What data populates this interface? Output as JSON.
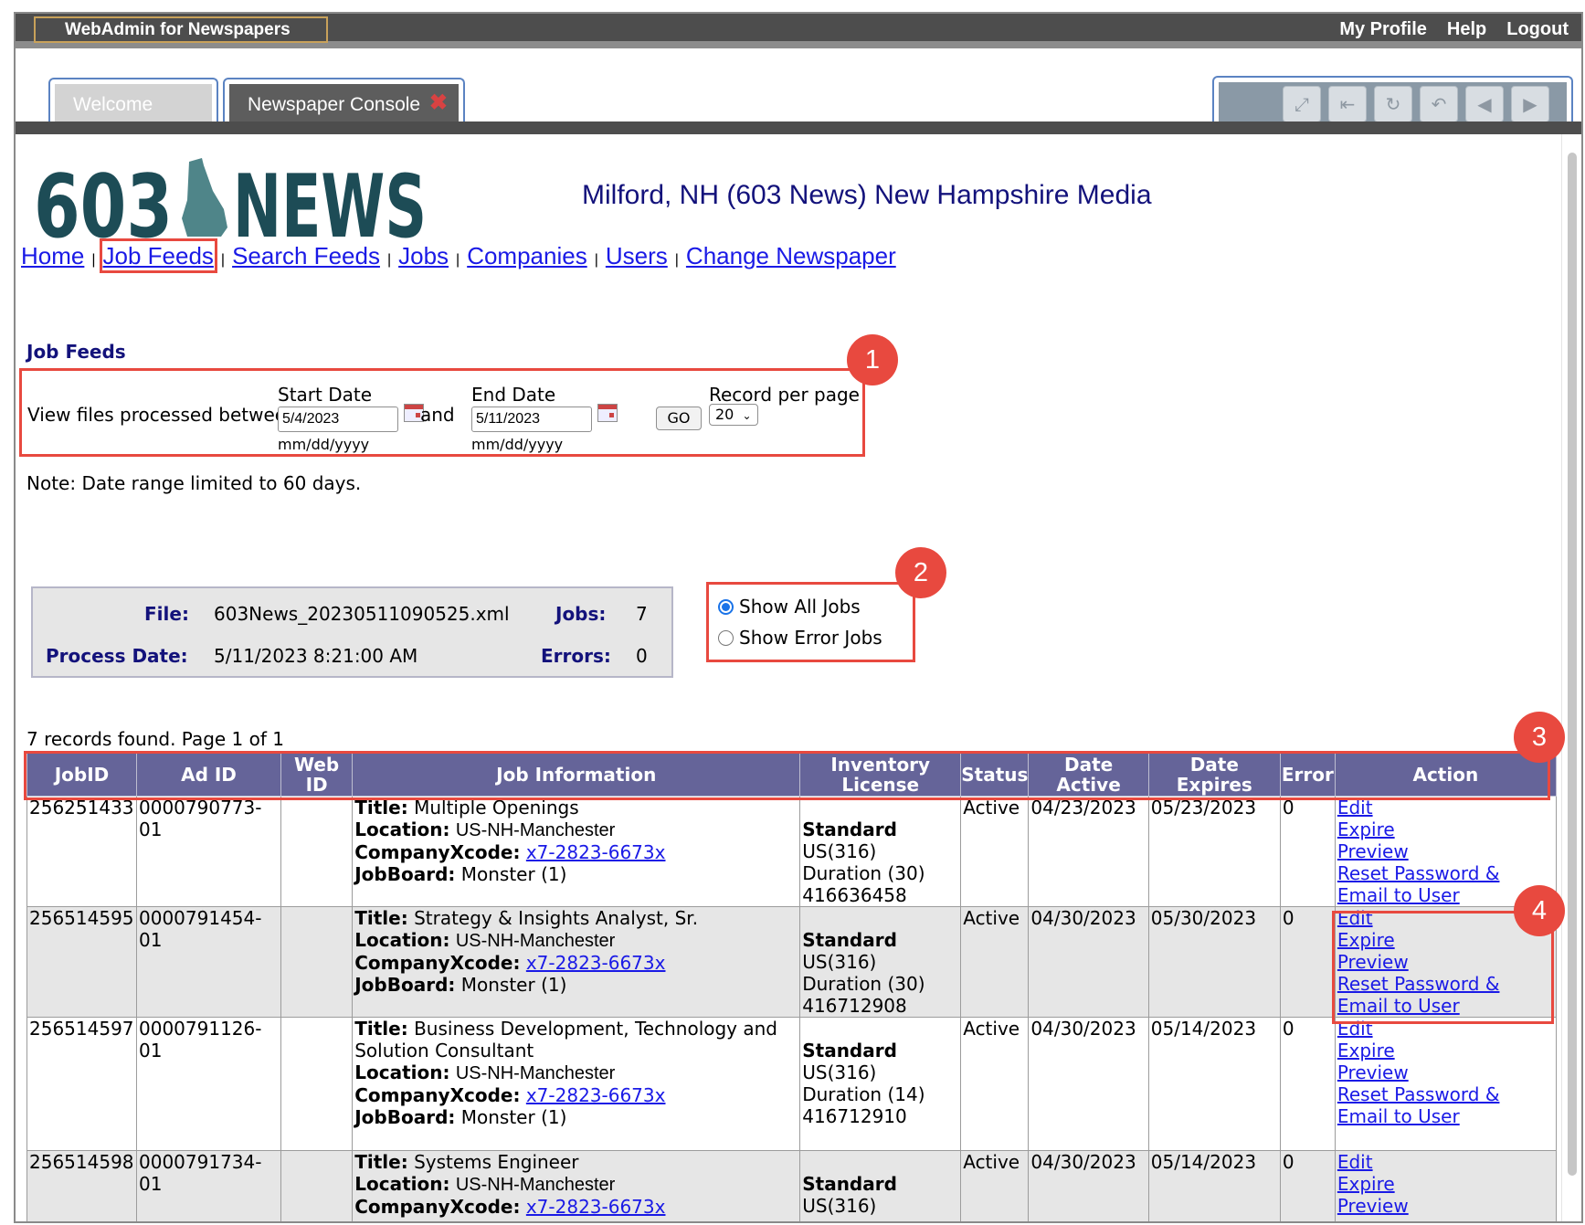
{
  "app": {
    "title": "WebAdmin for Newspapers",
    "top_links": [
      "My Profile",
      "Help",
      "Logout"
    ],
    "tabs": [
      {
        "label": "Welcome"
      },
      {
        "label": "Newspaper Console"
      }
    ],
    "tool_icons": [
      "maximize-icon",
      "first-page-icon",
      "refresh-icon",
      "undo-icon",
      "back-icon",
      "forward-icon"
    ]
  },
  "site": {
    "logo_text_left": "603",
    "logo_text_right": "NEWS",
    "title": "Milford, NH (603 News) New Hampshire Media"
  },
  "nav": [
    "Home",
    "Job Feeds",
    "Search Feeds",
    "Jobs",
    "Companies",
    "Users",
    "Change Newspaper"
  ],
  "section_title": "Job Feeds",
  "filter": {
    "label": "View files processed between:",
    "start_label": "Start Date",
    "start_value": "5/4/2023",
    "start_hint": "mm/dd/yyyy",
    "and_text": "and",
    "end_label": "End Date",
    "end_value": "5/11/2023",
    "end_hint": "mm/dd/yyyy",
    "go_label": "GO",
    "per_page_label": "Record per page",
    "per_page_value": "20"
  },
  "note": "Note: Date range limited to 60 days.",
  "file_info": {
    "file_label": "File:",
    "file_value": "603News_20230511090525.xml",
    "jobs_label": "Jobs:",
    "jobs_value": "7",
    "process_label": "Process Date:",
    "process_value": "5/11/2023 8:21:00 AM",
    "errors_label": "Errors:",
    "errors_value": "0"
  },
  "radio": {
    "all": "Show All Jobs",
    "error": "Show Error Jobs"
  },
  "records_text": "7 records found. Page 1 of 1",
  "badges": [
    "1",
    "2",
    "3",
    "4"
  ],
  "table": {
    "headers": [
      "JobID",
      "Ad ID",
      "Web ID",
      "Job Information",
      "Inventory License",
      "Status",
      "Date Active",
      "Date Expires",
      "Error",
      "Action"
    ],
    "field_labels": {
      "title": "Title:",
      "location": "Location:",
      "company": "CompanyXcode:",
      "jobboard": "JobBoard:"
    },
    "actions": {
      "edit": "Edit",
      "expire": "Expire",
      "preview": "Preview",
      "reset1": "Reset Password &",
      "reset2": "Email to User"
    },
    "rows": [
      {
        "jobid": "256251433",
        "adid1": "0000790773-",
        "adid2": "01",
        "webid": "",
        "title": "Multiple Openings",
        "title2": "",
        "location": "US-NH-Manchester",
        "company": "x7-2823-6673x",
        "jobboard": "Monster (1)",
        "lic_type": "Standard",
        "lic_region": "US(316)",
        "lic_duration": "Duration (30)",
        "lic_id": "416636458",
        "status": "Active",
        "date_active": "04/23/2023",
        "date_expires": "05/23/2023",
        "error": "0"
      },
      {
        "jobid": "256514595",
        "adid1": "0000791454-",
        "adid2": "01",
        "webid": "",
        "title": "Strategy & Insights Analyst, Sr.",
        "title2": "",
        "location": "US-NH-Manchester",
        "company": "x7-2823-6673x",
        "jobboard": "Monster (1)",
        "lic_type": "Standard",
        "lic_region": "US(316)",
        "lic_duration": "Duration (30)",
        "lic_id": "416712908",
        "status": "Active",
        "date_active": "04/30/2023",
        "date_expires": "05/30/2023",
        "error": "0"
      },
      {
        "jobid": "256514597",
        "adid1": "0000791126-",
        "adid2": "01",
        "webid": "",
        "title": "Business Development, Technology and",
        "title2": "Solution Consultant",
        "location": "US-NH-Manchester",
        "company": "x7-2823-6673x",
        "jobboard": "Monster (1)",
        "lic_type": "Standard",
        "lic_region": "US(316)",
        "lic_duration": "Duration (14)",
        "lic_id": "416712910",
        "status": "Active",
        "date_active": "04/30/2023",
        "date_expires": "05/14/2023",
        "error": "0"
      },
      {
        "jobid": "256514598",
        "adid1": "0000791734-",
        "adid2": "01",
        "webid": "",
        "title": "Systems Engineer",
        "title2": "",
        "location": "US-NH-Manchester",
        "company": "x7-2823-6673x",
        "jobboard": "",
        "lic_type": "Standard",
        "lic_region": "US(316)",
        "lic_duration": "",
        "lic_id": "",
        "status": "Active",
        "date_active": "04/30/2023",
        "date_expires": "05/14/2023",
        "error": "0"
      }
    ]
  },
  "colors": {
    "accent_red": "#e8493f",
    "header_purple": "#656499",
    "link_blue": "#1a1ae6",
    "logo_teal": "#1d4c56"
  }
}
